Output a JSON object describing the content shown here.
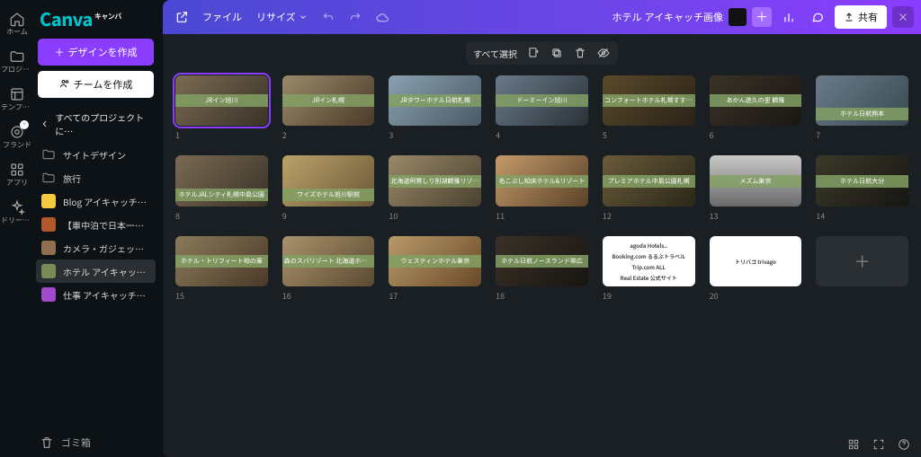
{
  "brand": {
    "name": "Canva",
    "superscript": "キャンバ"
  },
  "rail": {
    "items": [
      {
        "label": "ホーム",
        "icon": "home"
      },
      {
        "label": "プロジェク…",
        "icon": "folder"
      },
      {
        "label": "テンプレー…",
        "icon": "template"
      },
      {
        "label": "ブランド",
        "icon": "brand",
        "badge": "+"
      },
      {
        "label": "アプリ",
        "icon": "apps"
      },
      {
        "label": "ドリームラ…",
        "icon": "sparkle"
      }
    ]
  },
  "sidebar": {
    "create_design": "デザインを作成",
    "create_team": "チームを作成",
    "back_label": "すべてのプロジェクトに…",
    "items": [
      {
        "label": "サイトデザイン",
        "kind": "folder",
        "color": "#555"
      },
      {
        "label": "旅行",
        "kind": "folder",
        "color": "#555"
      },
      {
        "label": "Blog アイキャッチ画像",
        "kind": "design",
        "color": "#f6c945"
      },
      {
        "label": "【車中泊で日本一周ひと…",
        "kind": "design",
        "color": "#b1582b"
      },
      {
        "label": "カメラ・ガジェット アイ…",
        "kind": "design",
        "color": "#8e6f4f"
      },
      {
        "label": "ホテル アイキャッチ画像",
        "kind": "design",
        "color": "#7a8c55",
        "active": true
      },
      {
        "label": "仕事 アイキャッチ画像",
        "kind": "design",
        "color": "#a14acb"
      }
    ],
    "trash": "ゴミ箱"
  },
  "topbar": {
    "file": "ファイル",
    "resize": "リサイズ",
    "title": "ホテル アイキャッチ画像",
    "share": "共有"
  },
  "toolbar": {
    "select_all": "すべて選択"
  },
  "grid": {
    "items": [
      {
        "n": 1,
        "title": "JRイン旭川",
        "band": "mid",
        "bg": "linear-gradient(135deg,#7a6a52,#3a3228)",
        "selected": true
      },
      {
        "n": 2,
        "title": "JRイン札幌",
        "band": "mid",
        "bg": "linear-gradient(135deg,#9a8a6a,#4a3a28)"
      },
      {
        "n": 3,
        "title": "JRタワーホテル日航札幌",
        "band": "mid",
        "bg": "linear-gradient(135deg,#8aa0b0,#4a5a66)"
      },
      {
        "n": 4,
        "title": "ドーミーイン旭川",
        "band": "mid",
        "bg": "linear-gradient(135deg,#6a7a8a,#2a3238)"
      },
      {
        "n": 5,
        "title": "コンフォートホテル札幌すすきの",
        "band": "mid",
        "bg": "linear-gradient(135deg,#5a4a2a,#2a2218)"
      },
      {
        "n": 6,
        "title": "あかん遊久の里 鶴雅",
        "band": "mid",
        "bg": "linear-gradient(135deg,#3a3228,#1a1612)"
      },
      {
        "n": 7,
        "title": "ホテル日航熊本",
        "band": "bot",
        "bg": "linear-gradient(135deg,#6a7a8a,#3a4a50)"
      },
      {
        "n": 8,
        "title": "ホテルJALシティ札幌中島公園",
        "band": "bot",
        "bg": "linear-gradient(135deg,#7a6a52,#3a3228)"
      },
      {
        "n": 9,
        "title": "ワイズホテル旭川駅前",
        "band": "bot",
        "bg": "linear-gradient(135deg,#bba26a,#6a5838)"
      },
      {
        "n": 10,
        "title": "北海道阿寒しり別湖鶴雅リゾート",
        "band": "mid",
        "bg": "linear-gradient(135deg,#9a8868,#4a4230)"
      },
      {
        "n": 11,
        "title": "名こぶし知床ホテル&リゾート",
        "band": "mid",
        "bg": "linear-gradient(135deg,#c49a6a,#5a4228)"
      },
      {
        "n": 12,
        "title": "プレミアホテル中島公園札幌",
        "band": "mid",
        "bg": "linear-gradient(135deg,#6a5a3a,#2a2818)"
      },
      {
        "n": 13,
        "title": "メズム東京",
        "band": "mid",
        "bg": "linear-gradient(180deg,#c8c8c8,#6a6a6a)"
      },
      {
        "n": 14,
        "title": "ホテル日航大分",
        "band": "mid",
        "bg": "linear-gradient(135deg,#3a3a2a,#161612)"
      },
      {
        "n": 15,
        "title": "ホテル・トリフィート柏の葉",
        "band": "mid",
        "bg": "linear-gradient(135deg,#8a7a5a,#4a3a28)"
      },
      {
        "n": 16,
        "title": "森のスパリゾート 北海道ホテル",
        "band": "mid",
        "bg": "linear-gradient(135deg,#aa926a,#5a4a32)"
      },
      {
        "n": 17,
        "title": "ウェスティンホテル東京",
        "band": "mid",
        "bg": "linear-gradient(135deg,#b89a6a,#6a4a28)"
      },
      {
        "n": 18,
        "title": "ホテル日航ノースランド帯広",
        "band": "mid",
        "bg": "linear-gradient(135deg,#3a3228,#181410)"
      },
      {
        "n": 19,
        "kind": "white",
        "lines": [
          "agoda   Hotels..",
          "Booking.com   るるぶトラベル",
          "Trip.com   ALL",
          "Real Estate   公式サイト"
        ]
      },
      {
        "n": 20,
        "kind": "white",
        "lines": [
          "トリバゴ trivago"
        ]
      },
      {
        "n": "",
        "kind": "add"
      }
    ]
  },
  "colors": {
    "accent": "#8b3dff"
  }
}
